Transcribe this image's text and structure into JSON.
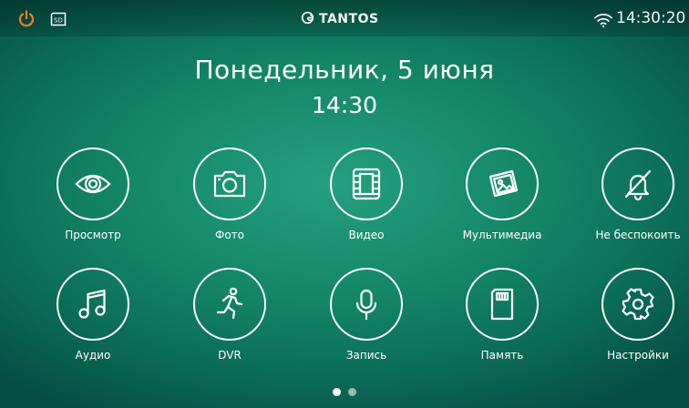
{
  "status_bar": {
    "brand": "TANTOS",
    "clock": "14:30:20",
    "icons": [
      "power-icon",
      "sd-card-icon",
      "tantos-logo-icon",
      "wifi-icon"
    ],
    "power_color": "#ff7a2a"
  },
  "date": "Понедельник, 5 июня",
  "time": "14:30",
  "menu": {
    "row1": [
      {
        "label": "Просмотр",
        "icon": "eye-icon"
      },
      {
        "label": "Фото",
        "icon": "camera-icon"
      },
      {
        "label": "Видео",
        "icon": "film-icon"
      },
      {
        "label": "Мультимедиа",
        "icon": "pictures-icon"
      },
      {
        "label": "Не беспокоить",
        "icon": "bell-off-icon"
      }
    ],
    "row2": [
      {
        "label": "Аудио",
        "icon": "music-note-icon"
      },
      {
        "label": "DVR",
        "icon": "running-man-icon"
      },
      {
        "label": "Запись",
        "icon": "microphone-icon"
      },
      {
        "label": "Память",
        "icon": "memory-card-icon"
      },
      {
        "label": "Настройки",
        "icon": "gear-icon"
      }
    ]
  },
  "pager": {
    "pages": 2,
    "active": 1,
    "active_color": "#ffffff",
    "inactive_color": "#9fb8b0"
  }
}
